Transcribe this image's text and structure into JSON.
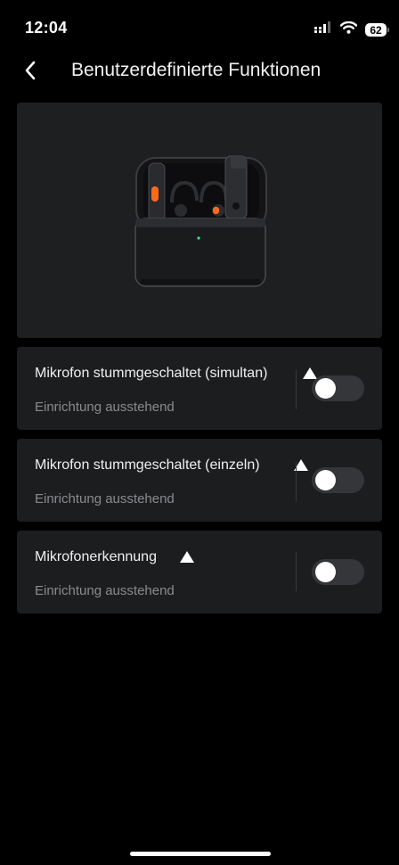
{
  "status_bar": {
    "time": "12:04",
    "battery": "62"
  },
  "header": {
    "title": "Benutzerdefinierte Funktionen",
    "back_icon": "chevron-left-icon"
  },
  "product": {
    "image": "microphone-charging-case"
  },
  "settings": [
    {
      "title": "Mikrofon stummgeschaltet (simultan)",
      "subtitle": "Einrichtung ausstehend",
      "enabled": false
    },
    {
      "title": "Mikrofon stummgeschaltet (einzeln)",
      "subtitle": "Einrichtung ausstehend",
      "enabled": false
    },
    {
      "title": "Mikrofonerkennung",
      "subtitle": "Einrichtung ausstehend",
      "enabled": false
    }
  ],
  "colors": {
    "background": "#000000",
    "card": "#1c1d1f",
    "toggle_off": "#34363a",
    "accent": "#ff6a1a"
  }
}
